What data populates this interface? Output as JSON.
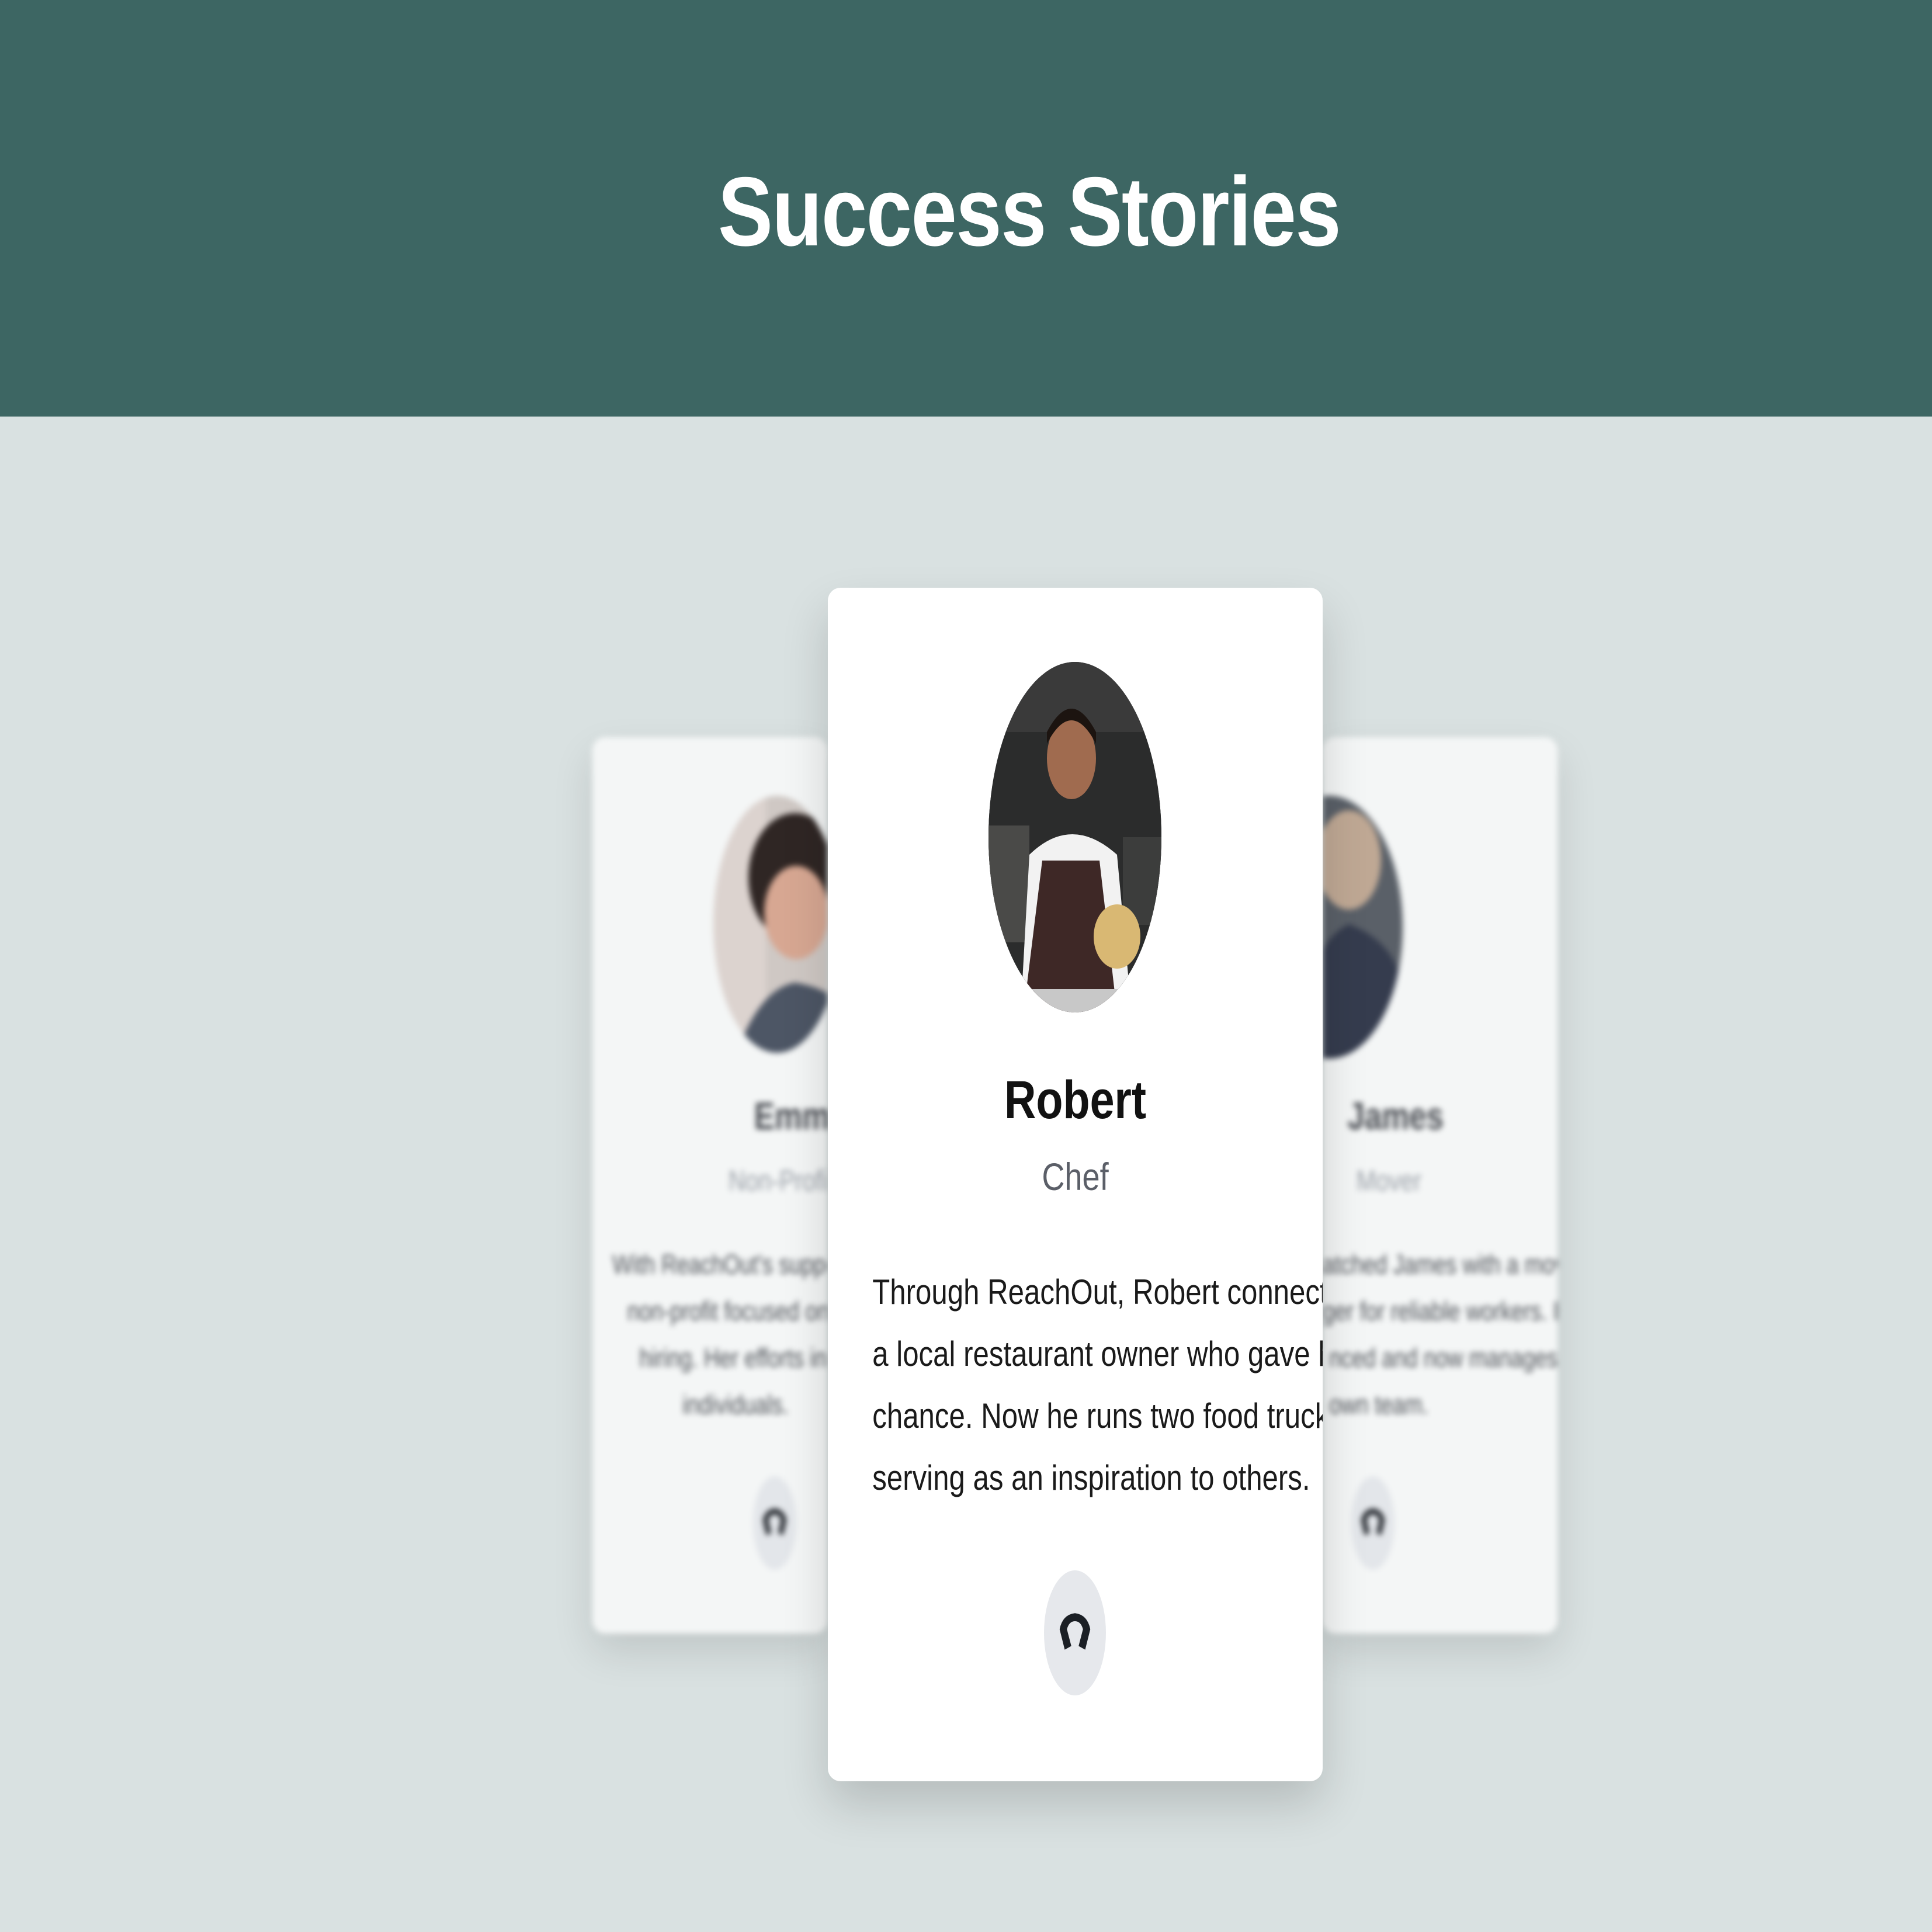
{
  "page": {
    "title": "Success Stories"
  },
  "stories": {
    "left": {
      "name": "Emma",
      "role": "Non-Profit Lead",
      "text_lines": [
        "With ReachOut's support, Em",
        "non-profit focused on sec",
        "hiring. Her efforts inspire",
        "individuals."
      ],
      "icon": "link-icon"
    },
    "center": {
      "name": "Robert",
      "role": "Chef",
      "text_lines": [
        "Through ReachOut, Robert connected with",
        "a local restaurant owner who gave him a",
        "chance. Now he runs two food trucks,",
        "serving as an inspiration to others."
      ],
      "icon": "link-icon"
    },
    "right": {
      "name": "James",
      "role": "Mover",
      "text_lines": [
        "atched James with a moving",
        "ger for reliable workers. He",
        "nced and now manages his",
        "own team."
      ],
      "icon": "link-icon"
    }
  },
  "colors": {
    "header_bg": "#3d6663",
    "page_bg": "#d9e1e1",
    "card_bg": "#ffffff"
  }
}
